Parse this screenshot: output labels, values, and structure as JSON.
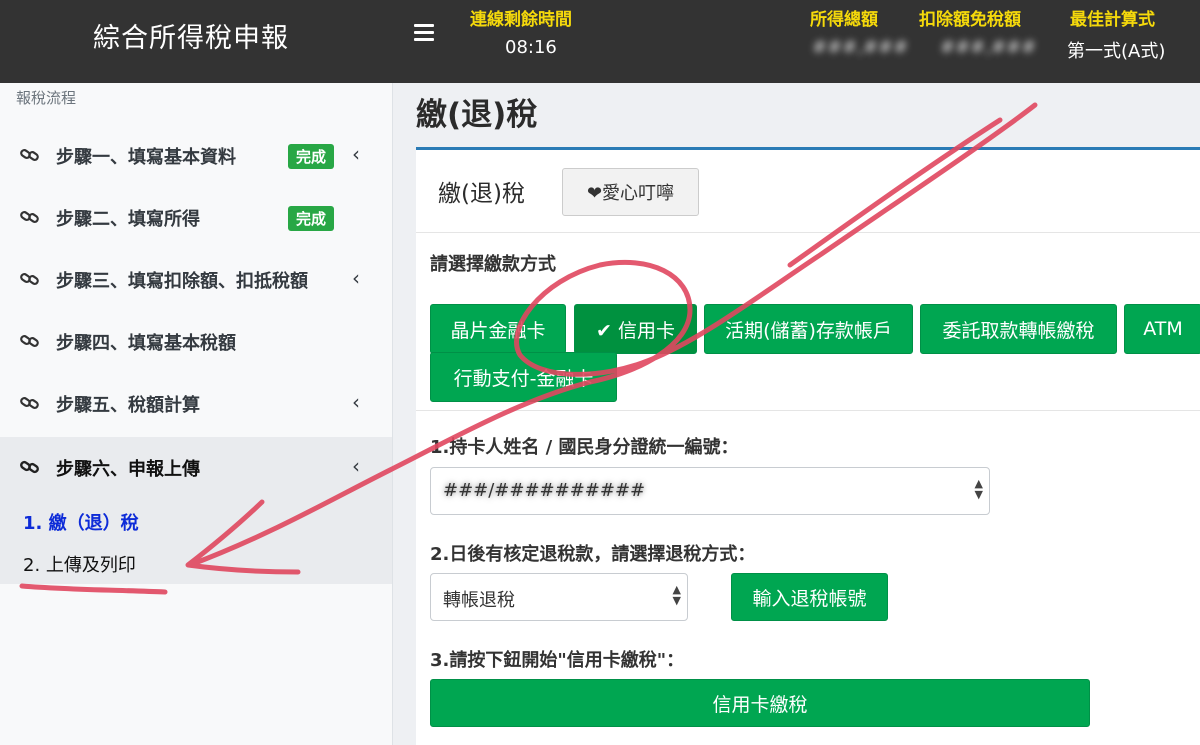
{
  "header": {
    "app_title": "綜合所得稅申報",
    "session_label": "連線剩餘時間",
    "session_time": "08:16",
    "income_label": "所得總額",
    "income_value": "###,###",
    "deduction_label": "扣除額免稅額",
    "deduction_value": "###,###",
    "best_method_label": "最佳計算式",
    "best_method_value": "第一式(A式)"
  },
  "sidebar": {
    "heading": "報稅流程",
    "steps": [
      {
        "label": "步驟一、填寫基本資料",
        "badge": "完成",
        "chevron": "‹"
      },
      {
        "label": "步驟二、填寫所得",
        "badge": "完成",
        "chevron": ""
      },
      {
        "label": "步驟三、填寫扣除額、扣抵稅額",
        "badge": "",
        "chevron": "‹"
      },
      {
        "label": "步驟四、填寫基本稅額",
        "badge": "",
        "chevron": ""
      },
      {
        "label": "步驟五、稅額計算",
        "badge": "",
        "chevron": "‹"
      },
      {
        "label": "步驟六、申報上傳",
        "badge": "",
        "chevron": "‹"
      }
    ],
    "substeps": [
      {
        "label": "1. 繳（退）稅"
      },
      {
        "label": "2. 上傳及列印"
      }
    ]
  },
  "main": {
    "page_title": "繳(退)稅",
    "card_title": "繳(退)稅",
    "reminder_button": "❤愛心叮嚀",
    "payment_section_label": "請選擇繳款方式",
    "payment_methods": [
      {
        "label": "晶片金融卡"
      },
      {
        "label": "✔ 信用卡"
      },
      {
        "label": "活期(儲蓄)存款帳戶"
      },
      {
        "label": "委託取款轉帳繳稅"
      },
      {
        "label": "ATM"
      },
      {
        "label": "行動支付-金融卡"
      }
    ],
    "field1_label": "1.持卡人姓名 / 國民身分證統一編號：",
    "field1_value": "###/##########",
    "field2_label": "2.日後有核定退稅款，請選擇退稅方式：",
    "field2_value": "轉帳退稅",
    "refund_account_button": "輸入退稅帳號",
    "field3_label": "3.請按下鈕開始\"信用卡繳稅\"：",
    "credit_pay_button": "信用卡繳稅"
  },
  "colors": {
    "accent_green": "#00a651",
    "header_yellow": "#f5d90b",
    "active_substep_blue": "#0d2bd8",
    "annotation_red": "#e0475f"
  }
}
